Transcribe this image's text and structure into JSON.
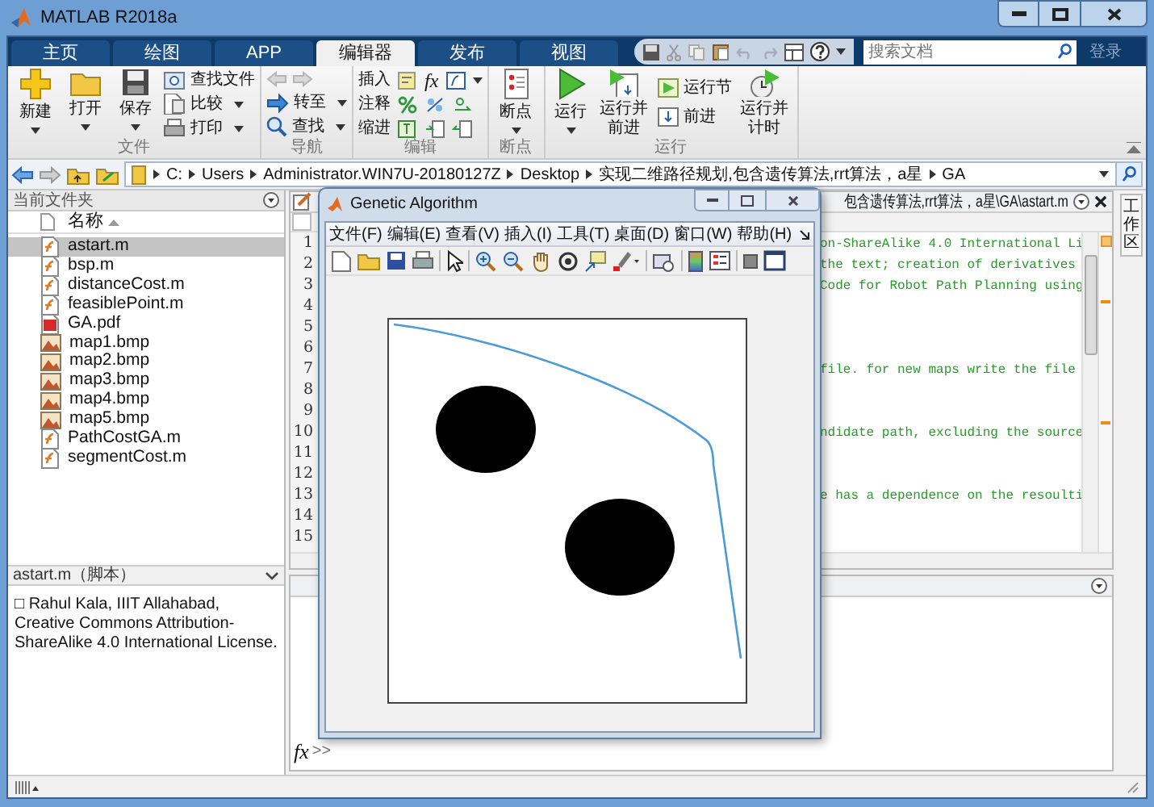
{
  "window": {
    "title": "MATLAB R2018a"
  },
  "tabs": [
    {
      "label": "主页",
      "selected": false
    },
    {
      "label": "绘图",
      "selected": false
    },
    {
      "label": "APP",
      "selected": false
    },
    {
      "label": "编辑器",
      "selected": true
    },
    {
      "label": "发布",
      "selected": false
    },
    {
      "label": "视图",
      "selected": false
    }
  ],
  "search": {
    "placeholder": "搜索文档"
  },
  "login": "登录",
  "ribbon": {
    "file": {
      "label": "文件",
      "new": "新建",
      "open": "打开",
      "save": "保存",
      "find_files": "查找文件",
      "compare": "比较",
      "print": "打印"
    },
    "navigate": {
      "label": "导航",
      "go_to": "转至",
      "find": "查找"
    },
    "edit": {
      "label": "编辑",
      "insert": "插入",
      "comment": "注释",
      "indent": "缩进",
      "fx": "fx"
    },
    "breakpoints": {
      "label": "断点",
      "button": "断点"
    },
    "run": {
      "label": "运行",
      "run": "运行",
      "run_and_advance": "运行并前进",
      "run_section": "运行节",
      "advance": "前进",
      "run_and_time": "运行并计时"
    }
  },
  "address": {
    "crumbs": [
      "C:",
      "Users",
      "Administrator.WIN7U-20180127Z",
      "Desktop",
      "实现二维路径规划,包含遗传算法,rrt算法，a星",
      "GA"
    ]
  },
  "files": {
    "title": "当前文件夹",
    "column": "名称",
    "items": [
      {
        "name": "astart.m",
        "kind": "script",
        "selected": true
      },
      {
        "name": "bsp.m",
        "kind": "script",
        "selected": false
      },
      {
        "name": "distanceCost.m",
        "kind": "script",
        "selected": false
      },
      {
        "name": "feasiblePoint.m",
        "kind": "script",
        "selected": false
      },
      {
        "name": "GA.pdf",
        "kind": "pdf",
        "selected": false
      },
      {
        "name": "map1.bmp",
        "kind": "image",
        "selected": false
      },
      {
        "name": "map2.bmp",
        "kind": "image",
        "selected": false
      },
      {
        "name": "map3.bmp",
        "kind": "image",
        "selected": false
      },
      {
        "name": "map4.bmp",
        "kind": "image",
        "selected": false
      },
      {
        "name": "map5.bmp",
        "kind": "image",
        "selected": false
      },
      {
        "name": "PathCostGA.m",
        "kind": "script",
        "selected": false
      },
      {
        "name": "segmentCost.m",
        "kind": "script",
        "selected": false
      }
    ]
  },
  "details": {
    "title": "astart.m（脚本）",
    "text": "□ Rahul Kala, IIIT Allahabad, Creative Commons Attribution-ShareAlike 4.0 International License."
  },
  "editor": {
    "title": "包含遗传算法,rrt算法，a星\\GA\\astart.m",
    "lines": [
      {
        "number": "1",
        "code": "on-ShareAlike 4.0 International Li"
      },
      {
        "number": "2",
        "code": "the text; creation of derivatives"
      },
      {
        "number": "3",
        "code": "Code for Robot Path Planning using"
      },
      {
        "number": "4"
      },
      {
        "number": "5"
      },
      {
        "number": "6"
      },
      {
        "number": "7",
        "code": "file. for new maps write the file"
      },
      {
        "number": "8"
      },
      {
        "number": "9"
      },
      {
        "number": "10",
        "code": "ndidate path, excluding the source"
      },
      {
        "number": "11"
      },
      {
        "number": "12"
      },
      {
        "number": "13",
        "code": "e has a dependence on the resoulti"
      },
      {
        "number": "14"
      },
      {
        "number": "15"
      }
    ]
  },
  "command": {
    "fx": "fx",
    "prompt": ">>"
  },
  "workspace_tab": "工作区",
  "figure": {
    "title": "Genetic Algorithm",
    "menu": [
      "文件(F)",
      "编辑(E)",
      "查看(V)",
      "插入(I)",
      "工具(T)",
      "桌面(D)",
      "窗口(W)",
      "帮助(H)"
    ]
  }
}
